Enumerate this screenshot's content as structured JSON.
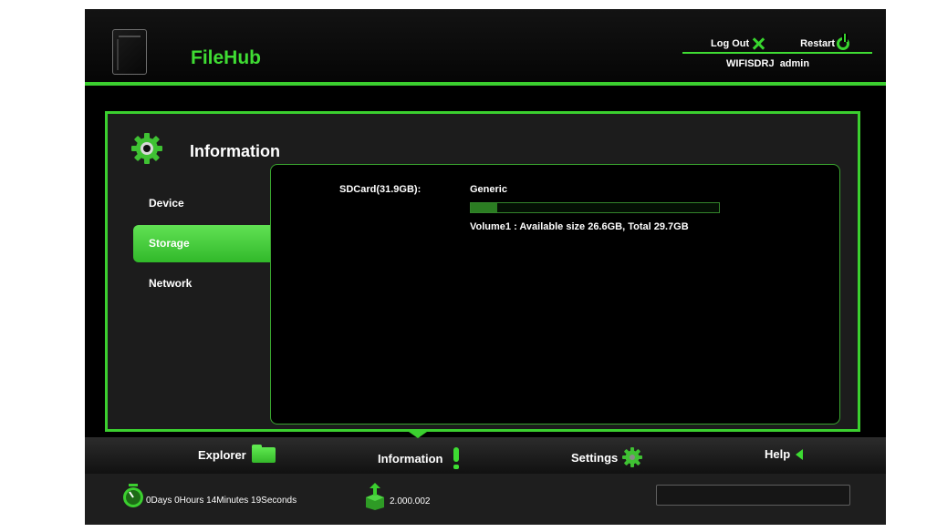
{
  "header": {
    "brand": "FileHub",
    "logout_label": "Log Out",
    "restart_label": "Restart",
    "device_name": "WIFISDRJ",
    "username": "admin"
  },
  "panel": {
    "title": "Information",
    "sidenav": [
      {
        "label": "Device",
        "active": false
      },
      {
        "label": "Storage",
        "active": true
      },
      {
        "label": "Network",
        "active": false
      }
    ],
    "storage": {
      "sdcard_label": "SDCard(31.9GB):",
      "vendor": "Generic",
      "usage_fraction": 0.105,
      "volume_info": "Volume1 : Available size 26.6GB, Total 29.7GB"
    }
  },
  "bottom_nav": [
    {
      "label": "Explorer",
      "icon": "folder-icon"
    },
    {
      "label": "Information",
      "icon": "exclamation-icon"
    },
    {
      "label": "Settings",
      "icon": "gear-icon"
    },
    {
      "label": "Help",
      "icon": "back-arrow-icon"
    }
  ],
  "status": {
    "uptime": "0Days 0Hours 14Minutes 19Seconds",
    "version": "2.000.002"
  },
  "colors": {
    "accent": "#3bcf2f",
    "background": "#000000",
    "panel": "#1c1c1c"
  }
}
